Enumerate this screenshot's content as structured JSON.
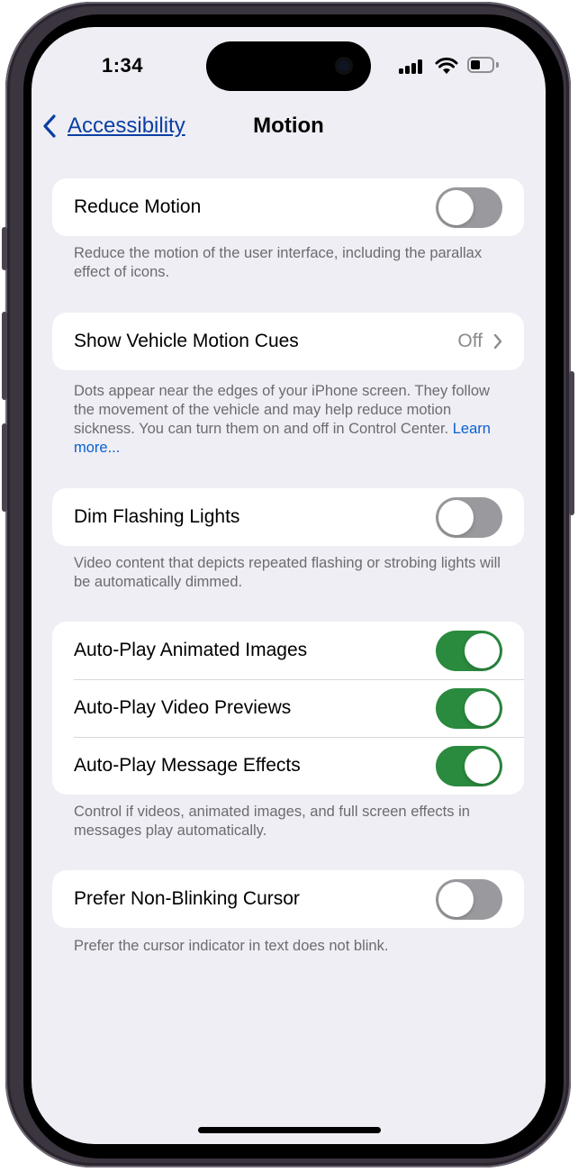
{
  "status_bar": {
    "time": "1:34"
  },
  "nav": {
    "back_label": "Accessibility",
    "title": "Motion",
    "accent": "#0a3fa3"
  },
  "sections": {
    "reduce_motion": {
      "label": "Reduce Motion",
      "toggle": "off",
      "footer": "Reduce the motion of the user interface, including the parallax effect of icons."
    },
    "vehicle_motion": {
      "label": "Show Vehicle Motion Cues",
      "value": "Off",
      "footer": "Dots appear near the edges of your iPhone screen. They follow the movement of the vehicle and may help reduce motion sickness. You can turn them on and off in Control Center.",
      "footer_link": "Learn more..."
    },
    "dim_flashing": {
      "label": "Dim Flashing Lights",
      "toggle": "off",
      "footer": "Video content that depicts repeated flashing or strobing lights will be automatically dimmed."
    },
    "autoplay": {
      "rows": [
        {
          "label": "Auto-Play Animated Images",
          "toggle": "on"
        },
        {
          "label": "Auto-Play Video Previews",
          "toggle": "on"
        },
        {
          "label": "Auto-Play Message Effects",
          "toggle": "on"
        }
      ],
      "footer": "Control if videos, animated images, and full screen effects in messages play automatically."
    },
    "cursor": {
      "label": "Prefer Non-Blinking Cursor",
      "toggle": "off",
      "footer": "Prefer the cursor indicator in text does not blink."
    }
  },
  "colors": {
    "background": "#efeef4",
    "toggle_on": "#2a8a3e",
    "toggle_off": "#9a9a9e",
    "link": "#0a5fd0"
  },
  "icons": {
    "back": "chevron-left-icon",
    "disclosure": "chevron-right-icon",
    "signal": "cellular-signal-icon",
    "wifi": "wifi-icon",
    "battery": "battery-icon"
  }
}
